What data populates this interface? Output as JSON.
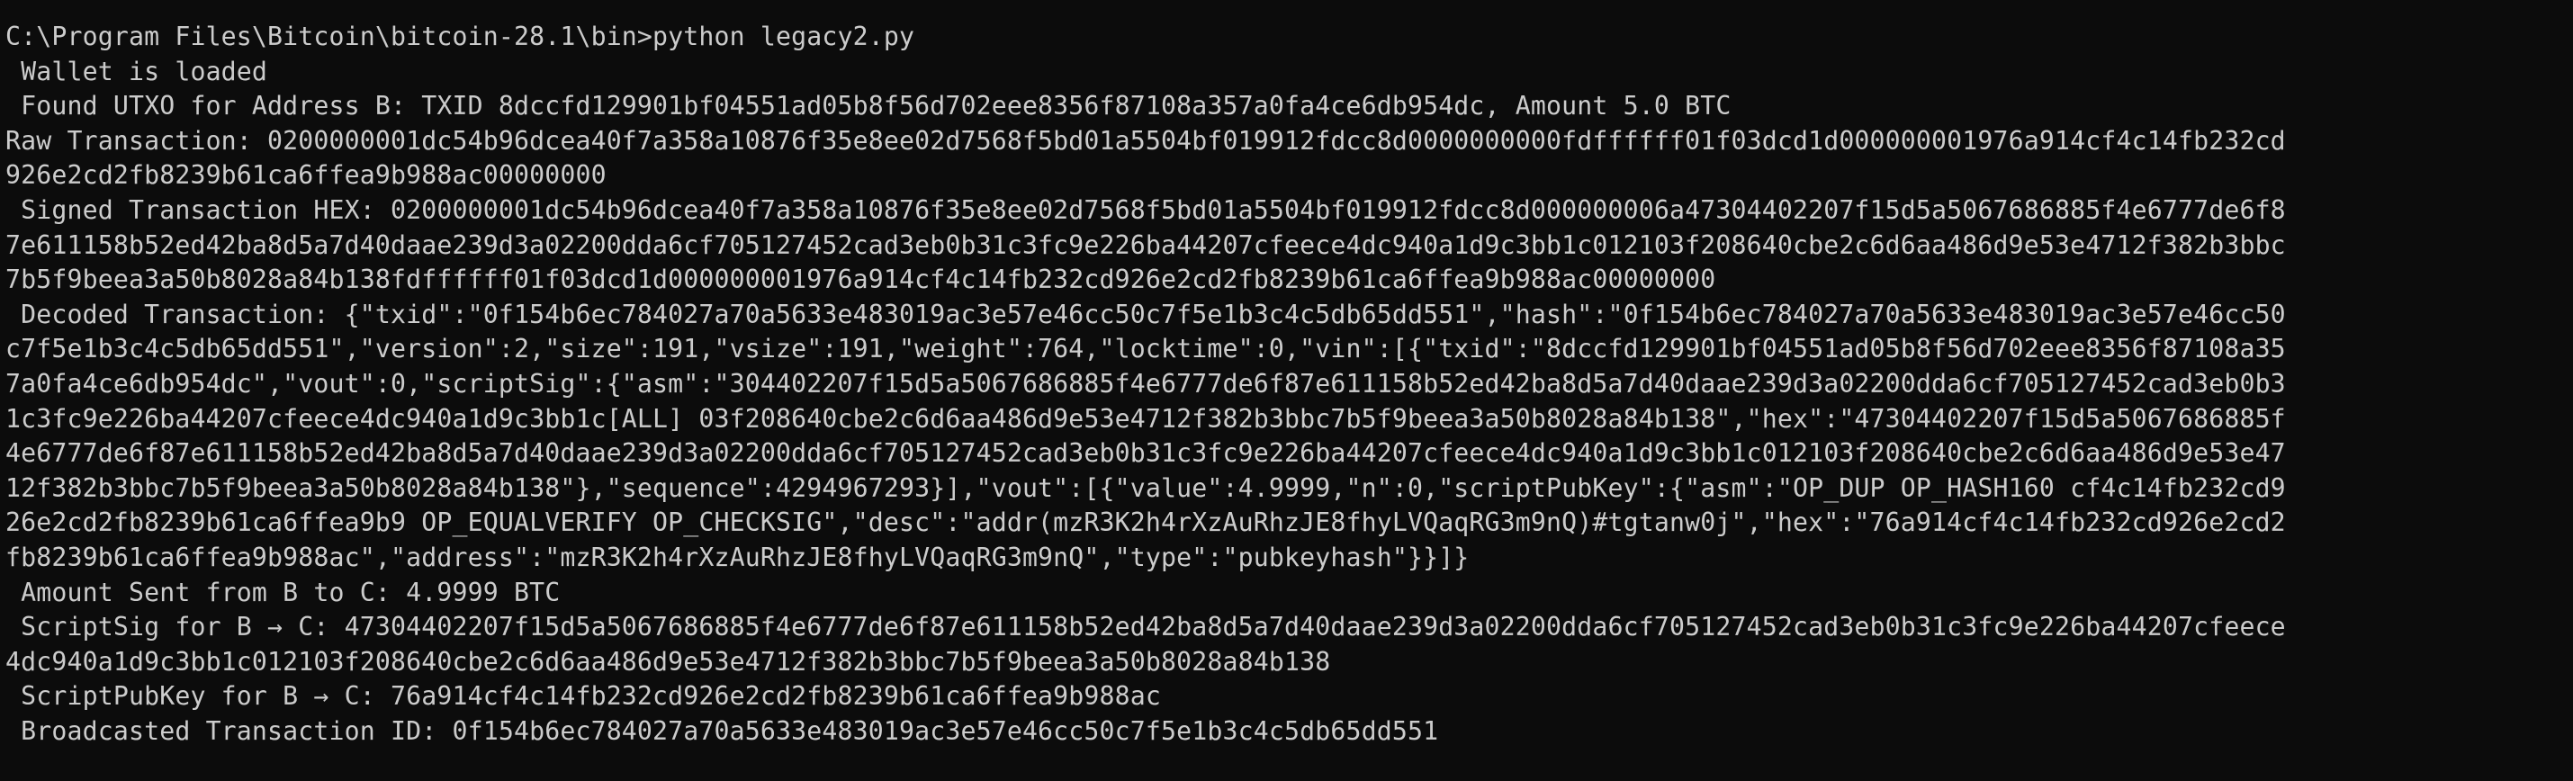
{
  "terminal": {
    "lines": [
      "C:\\Program Files\\Bitcoin\\bitcoin-28.1\\bin>python legacy2.py",
      " Wallet is loaded",
      " Found UTXO for Address B: TXID 8dccfd129901bf04551ad05b8f56d702eee8356f87108a357a0fa4ce6db954dc, Amount 5.0 BTC",
      "Raw Transaction: 0200000001dc54b96dcea40f7a358a10876f35e8ee02d7568f5bd01a5504bf019912fdcc8d0000000000fdffffff01f03dcd1d000000001976a914cf4c14fb232cd",
      "926e2cd2fb8239b61ca6ffea9b988ac00000000",
      " Signed Transaction HEX: 0200000001dc54b96dcea40f7a358a10876f35e8ee02d7568f5bd01a5504bf019912fdcc8d000000006a47304402207f15d5a5067686885f4e6777de6f8",
      "7e611158b52ed42ba8d5a7d40daae239d3a02200dda6cf705127452cad3eb0b31c3fc9e226ba44207cfeece4dc940a1d9c3bb1c012103f208640cbe2c6d6aa486d9e53e4712f382b3bbc",
      "7b5f9beea3a50b8028a84b138fdffffff01f03dcd1d000000001976a914cf4c14fb232cd926e2cd2fb8239b61ca6ffea9b988ac00000000",
      " Decoded Transaction: {\"txid\":\"0f154b6ec784027a70a5633e483019ac3e57e46cc50c7f5e1b3c4c5db65dd551\",\"hash\":\"0f154b6ec784027a70a5633e483019ac3e57e46cc50",
      "c7f5e1b3c4c5db65dd551\",\"version\":2,\"size\":191,\"vsize\":191,\"weight\":764,\"locktime\":0,\"vin\":[{\"txid\":\"8dccfd129901bf04551ad05b8f56d702eee8356f87108a35",
      "7a0fa4ce6db954dc\",\"vout\":0,\"scriptSig\":{\"asm\":\"304402207f15d5a5067686885f4e6777de6f87e611158b52ed42ba8d5a7d40daae239d3a02200dda6cf705127452cad3eb0b3",
      "1c3fc9e226ba44207cfeece4dc940a1d9c3bb1c[ALL] 03f208640cbe2c6d6aa486d9e53e4712f382b3bbc7b5f9beea3a50b8028a84b138\",\"hex\":\"47304402207f15d5a5067686885f",
      "4e6777de6f87e611158b52ed42ba8d5a7d40daae239d3a02200dda6cf705127452cad3eb0b31c3fc9e226ba44207cfeece4dc940a1d9c3bb1c012103f208640cbe2c6d6aa486d9e53e47",
      "12f382b3bbc7b5f9beea3a50b8028a84b138\"},\"sequence\":4294967293}],\"vout\":[{\"value\":4.9999,\"n\":0,\"scriptPubKey\":{\"asm\":\"OP_DUP OP_HASH160 cf4c14fb232cd9",
      "26e2cd2fb8239b61ca6ffea9b9 OP_EQUALVERIFY OP_CHECKSIG\",\"desc\":\"addr(mzR3K2h4rXzAuRhzJE8fhyLVQaqRG3m9nQ)#tgtanw0j\",\"hex\":\"76a914cf4c14fb232cd926e2cd2",
      "fb8239b61ca6ffea9b988ac\",\"address\":\"mzR3K2h4rXzAuRhzJE8fhyLVQaqRG3m9nQ\",\"type\":\"pubkeyhash\"}}]}",
      " Amount Sent from B to C: 4.9999 BTC",
      " ScriptSig for B → C: 47304402207f15d5a5067686885f4e6777de6f87e611158b52ed42ba8d5a7d40daae239d3a02200dda6cf705127452cad3eb0b31c3fc9e226ba44207cfeece",
      "4dc940a1d9c3bb1c012103f208640cbe2c6d6aa486d9e53e4712f382b3bbc7b5f9beea3a50b8028a84b138",
      " ScriptPubKey for B → C: 76a914cf4c14fb232cd926e2cd2fb8239b61ca6ffea9b988ac",
      " Broadcasted Transaction ID: 0f154b6ec784027a70a5633e483019ac3e57e46cc50c7f5e1b3c4c5db65dd551"
    ]
  },
  "colors": {
    "background": "#0c0c0c",
    "text": "#cccccc"
  }
}
